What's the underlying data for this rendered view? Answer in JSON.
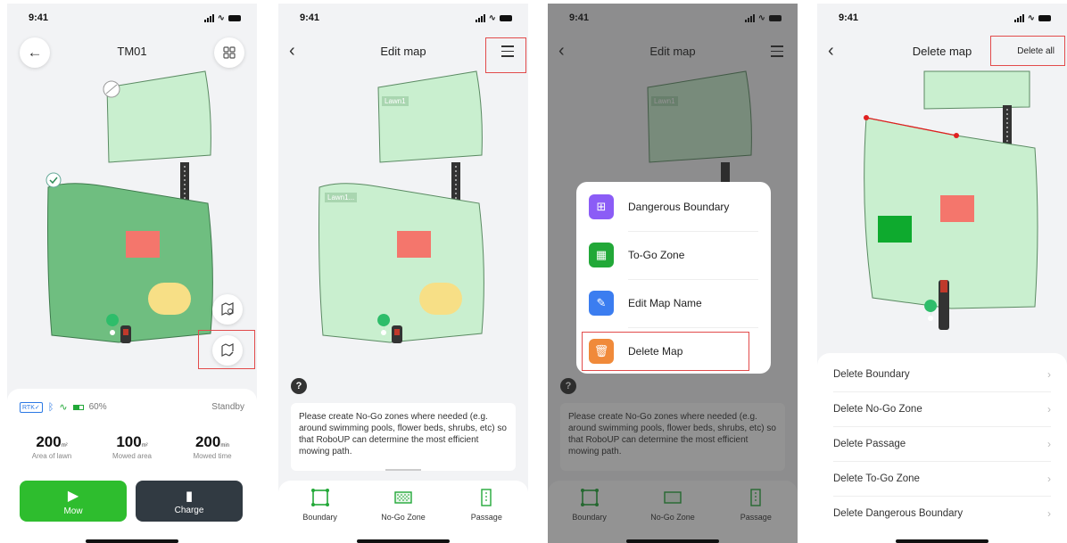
{
  "status_bar": {
    "time": "9:41"
  },
  "screen1": {
    "title": "TM01",
    "rtk_badge": "RTK",
    "battery_percent": "60%",
    "state": "Standby",
    "stats": [
      {
        "value": "200",
        "unit": "m²",
        "label": "Area of lawn"
      },
      {
        "value": "100",
        "unit": "m²",
        "label": "Mowed area"
      },
      {
        "value": "200",
        "unit": "min",
        "label": "Mowed time"
      }
    ],
    "mow_label": "Mow",
    "charge_label": "Charge",
    "colors": {
      "mow": "#2ebd2e",
      "charge": "#313a42"
    }
  },
  "screen2": {
    "title": "Edit map",
    "lawn_labels": [
      "Lawn1",
      "Lawn1..."
    ],
    "help_mark": "?",
    "tip": "Please create No-Go zones where needed (e.g. around swimming pools, flower beds, shrubs, etc) so that  RoboUP can determine the most efficient mowing path.",
    "tools": [
      {
        "icon": "boundary-icon",
        "label": "Boundary"
      },
      {
        "icon": "no-go-zone-icon",
        "label": "No-Go Zone"
      },
      {
        "icon": "passage-icon",
        "label": "Passage"
      }
    ]
  },
  "screen3": {
    "title": "Edit map",
    "lawn_label": "Lawn1",
    "menu": [
      {
        "icon": "plus-icon",
        "label": "Dangerous Boundary",
        "color": "#8b5cf6"
      },
      {
        "icon": "hatch-icon",
        "label": "To-Go Zone",
        "color": "#22a838"
      },
      {
        "icon": "edit-icon",
        "label": "Edit Map Name",
        "color": "#3b7df0"
      },
      {
        "icon": "trash-icon",
        "label": "Delete Map",
        "color": "#f08a3a"
      }
    ]
  },
  "screen4": {
    "title": "Delete map",
    "delete_all": "Delete all",
    "items": [
      "Delete Boundary",
      "Delete No-Go Zone",
      "Delete Passage",
      "Delete To-Go Zone",
      "Delete Dangerous Boundary"
    ]
  },
  "colors": {
    "lawn_light": "#c9efcf",
    "lawn_dark": "#6fbe80",
    "nogo": "#f4766c",
    "obstacle": "#f7df86",
    "highlight": "#e24b4b"
  }
}
